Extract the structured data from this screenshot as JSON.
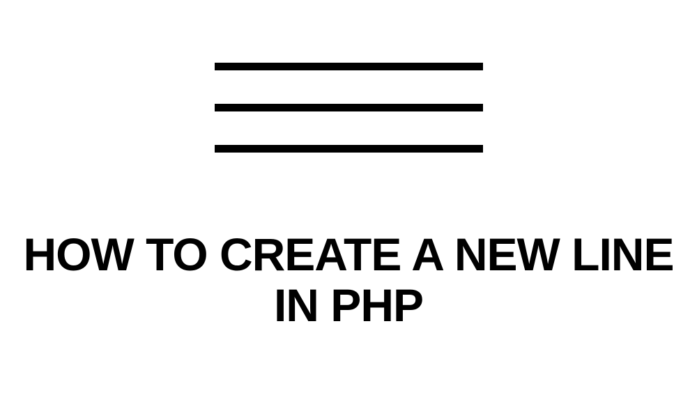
{
  "heading": "HOW TO CREATE A NEW LINE IN PHP"
}
